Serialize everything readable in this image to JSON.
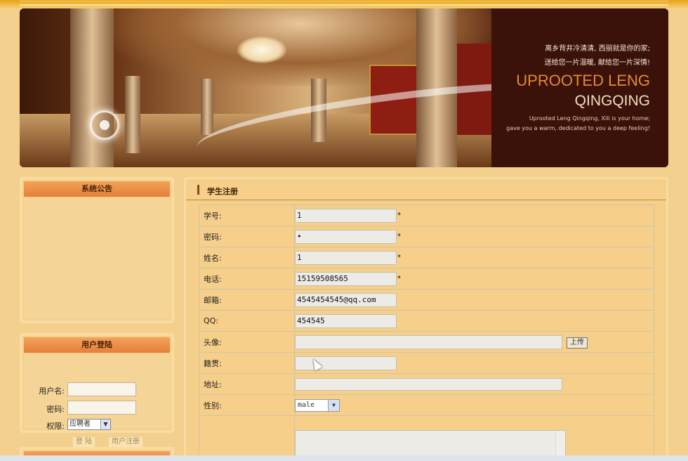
{
  "banner": {
    "cn_line1": "离乡背井冷清清, 西丽就是你的家;",
    "cn_line2": "送给您一片温暖, 献给您一片深情!",
    "en_title1": "UPROOTED LENG",
    "en_title2": "QINGQING",
    "en_sub1": "Uprooted Leng Qingqing, Xili is your home;",
    "en_sub2": "gave you a warm, dedicated to you a deep feeling!"
  },
  "sidebar": {
    "notice_title": "系统公告",
    "login_title": "用户登陆",
    "username_label": "用户名:",
    "password_label": "密码:",
    "permission_label": "权限:",
    "permission_value": "应聘者",
    "login_button": "登 陆",
    "register_button": "用户注册"
  },
  "main": {
    "title": "学生注册",
    "rows": [
      {
        "label": "学号:",
        "value": "1",
        "required": "*"
      },
      {
        "label": "密码:",
        "value": "•",
        "required": "*"
      },
      {
        "label": "姓名:",
        "value": "1",
        "required": "*"
      },
      {
        "label": "电话:",
        "value": "15159508565",
        "required": "*"
      },
      {
        "label": "邮箱:",
        "value": "4545454545@qq.com"
      },
      {
        "label": "QQ:",
        "value": "454545"
      },
      {
        "label": "头像:",
        "value": ""
      },
      {
        "label": "籍贯:",
        "value": ""
      },
      {
        "label": "地址:",
        "value": ""
      },
      {
        "label": "性别:",
        "value": "male"
      }
    ],
    "upload_button": "上传"
  },
  "colors": {
    "page_bg": "#f3d08e",
    "header_orange": "#e67f3a",
    "banner_dark": "#3b120a"
  }
}
